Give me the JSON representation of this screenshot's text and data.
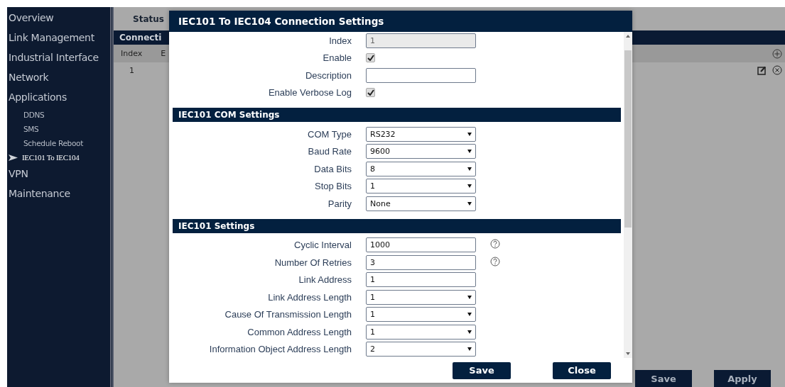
{
  "sidebar": {
    "items": [
      {
        "label": "Overview"
      },
      {
        "label": "Link Management"
      },
      {
        "label": "Industrial Interface"
      },
      {
        "label": "Network"
      },
      {
        "label": "Applications",
        "children": [
          {
            "label": "DDNS",
            "selected": false
          },
          {
            "label": "SMS",
            "selected": false
          },
          {
            "label": "Schedule Reboot",
            "selected": false
          },
          {
            "label": "IEC101 To IEC104",
            "selected": true
          }
        ]
      },
      {
        "label": "VPN"
      },
      {
        "label": "Maintenance"
      }
    ]
  },
  "page": {
    "tab": "Status",
    "section_title": "Connecti",
    "table": {
      "columns": [
        "Index",
        "E"
      ],
      "rows": [
        [
          "1"
        ]
      ]
    },
    "buttons": [
      "Save",
      "Apply"
    ]
  },
  "dialog": {
    "title": "IEC101 To IEC104 Connection Settings",
    "sections": [
      {
        "fields": [
          {
            "label": "Index",
            "kind": "text",
            "value": "1",
            "disabled": true
          },
          {
            "label": "Enable",
            "kind": "checkbox",
            "checked": true
          },
          {
            "label": "Description",
            "kind": "text"
          },
          {
            "label": "Enable Verbose Log",
            "kind": "checkbox",
            "checked": true
          }
        ]
      },
      {
        "title": "IEC101 COM Settings",
        "fields": [
          {
            "label": "COM Type",
            "kind": "select",
            "value": "RS232"
          },
          {
            "label": "Baud Rate",
            "kind": "select",
            "value": "9600"
          },
          {
            "label": "Data Bits",
            "kind": "select",
            "value": "8"
          },
          {
            "label": "Stop Bits",
            "kind": "select",
            "value": "1"
          },
          {
            "label": "Parity",
            "kind": "select",
            "value": "None"
          }
        ]
      },
      {
        "title": "IEC101 Settings",
        "fields": [
          {
            "label": "Cyclic Interval",
            "kind": "text",
            "value": "1000",
            "help": true
          },
          {
            "label": "Number Of Retries",
            "kind": "text",
            "value": "3",
            "help": true
          },
          {
            "label": "Link Address",
            "kind": "text",
            "value": "1"
          },
          {
            "label": "Link Address Length",
            "kind": "select",
            "value": "1"
          },
          {
            "label": "Cause Of Transmission Length",
            "kind": "select",
            "value": "1"
          },
          {
            "label": "Common Address Length",
            "kind": "select",
            "value": "1"
          },
          {
            "label": "Information Object Address Length",
            "kind": "select",
            "value": "2"
          }
        ]
      }
    ],
    "buttons": [
      "Save",
      "Close"
    ]
  }
}
